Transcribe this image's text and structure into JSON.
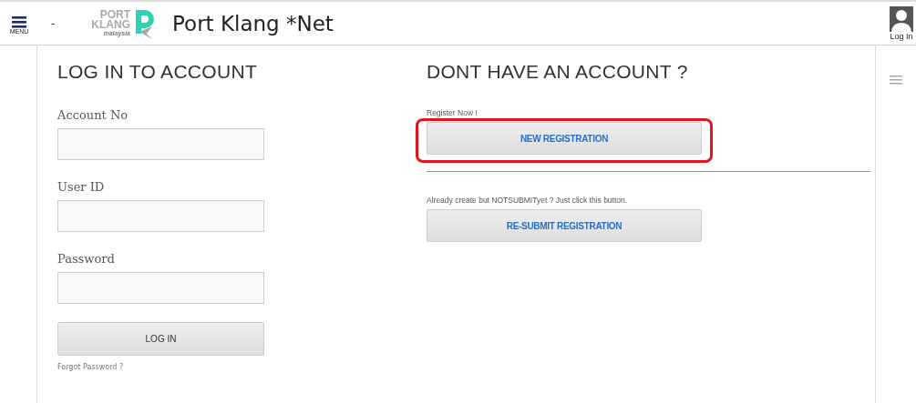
{
  "header": {
    "menu_label": "MENU",
    "dash": "-",
    "logo": {
      "line1": "PORT",
      "line2": "KLANG",
      "line3": "malaysia"
    },
    "title": "Port Klang *Net",
    "user_label": "Log In"
  },
  "login": {
    "heading": "LOG IN TO ACCOUNT",
    "fields": [
      {
        "label": "Account No"
      },
      {
        "label": "User ID"
      },
      {
        "label": "Password"
      }
    ],
    "button": "LOG IN",
    "forgot_link": "Forgot Password ?"
  },
  "register": {
    "heading": "DONT HAVE AN ACCOUNT ?",
    "sections": [
      {
        "note": "Register Now !",
        "button": "NEW REGISTRATION",
        "highlighted": true
      },
      {
        "note": "Already create but NOTSUBMITyet ? Just click this button.",
        "button": "RE-SUBMIT REGISTRATION",
        "highlighted": false
      }
    ]
  }
}
